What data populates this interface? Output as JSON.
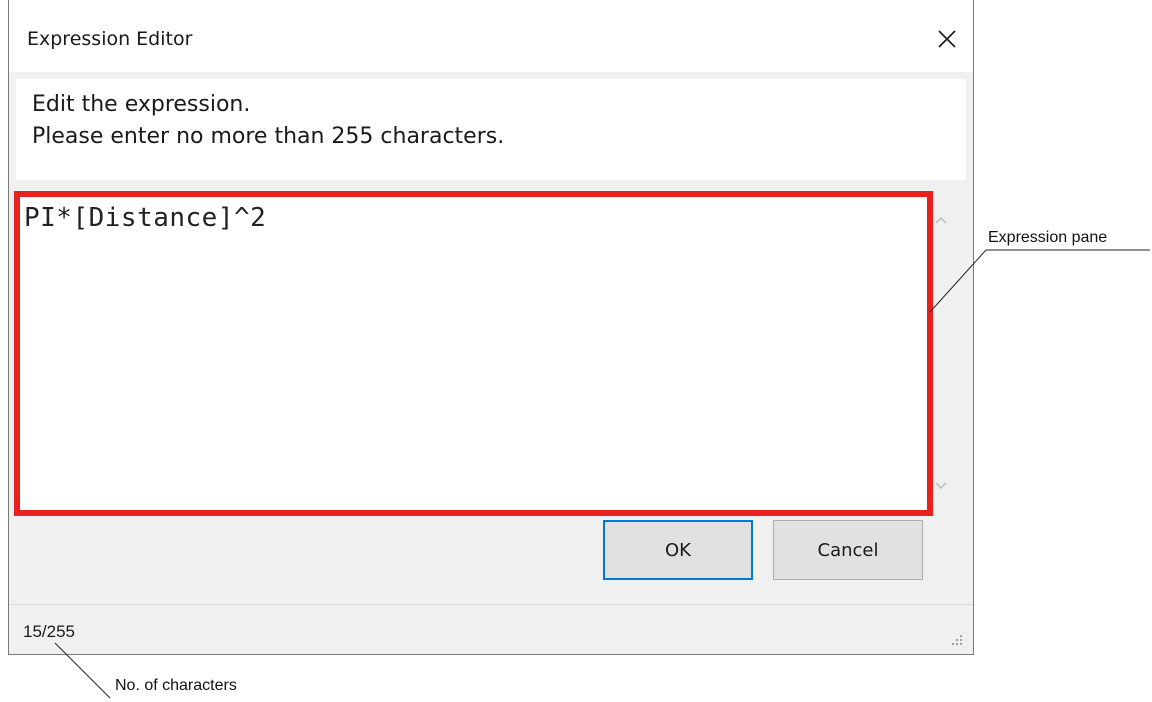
{
  "dialog": {
    "title": "Expression Editor",
    "close_icon": "close-icon",
    "instruction_line1": "Edit the expression.",
    "instruction_line2": "Please enter no more than 255 characters.",
    "expression": "PI*[Distance]^2",
    "ok_label": "OK",
    "cancel_label": "Cancel",
    "char_count": "15/255",
    "highlight_color": "#e8201e",
    "accent_color": "#0078d7"
  },
  "callouts": {
    "expression_pane": "Expression pane",
    "char_count": "No. of characters"
  }
}
